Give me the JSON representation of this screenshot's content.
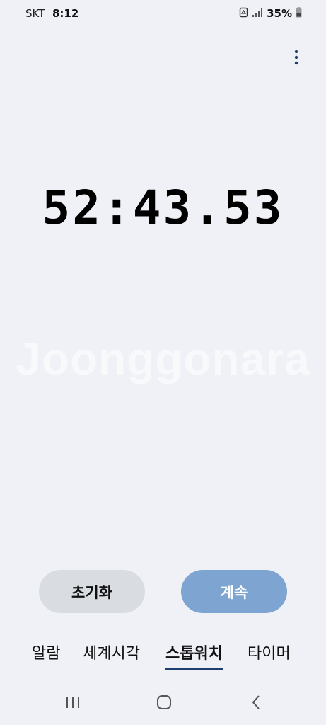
{
  "status_bar": {
    "carrier": "SKT",
    "time": "8:12",
    "battery_percent": "35%",
    "icons": [
      "recycle-icon",
      "signal-icon",
      "battery-icon"
    ]
  },
  "menu": {
    "icon": "more-vertical-icon"
  },
  "stopwatch": {
    "elapsed": "52:43.53"
  },
  "watermark": {
    "text": "Joonggonara"
  },
  "controls": {
    "reset_label": "초기화",
    "resume_label": "계속"
  },
  "tabs": [
    {
      "label": "알람",
      "active": false
    },
    {
      "label": "세계시각",
      "active": false
    },
    {
      "label": "스톱워치",
      "active": true
    },
    {
      "label": "타이머",
      "active": false
    }
  ],
  "nav_bar": {
    "icons": [
      "recent-apps-icon",
      "home-icon",
      "back-icon"
    ]
  },
  "colors": {
    "background": "#eff1f6",
    "resume_button": "#7ea4d1",
    "reset_button": "#d9dde2",
    "active_tab_underline": "#1f3e6e"
  }
}
